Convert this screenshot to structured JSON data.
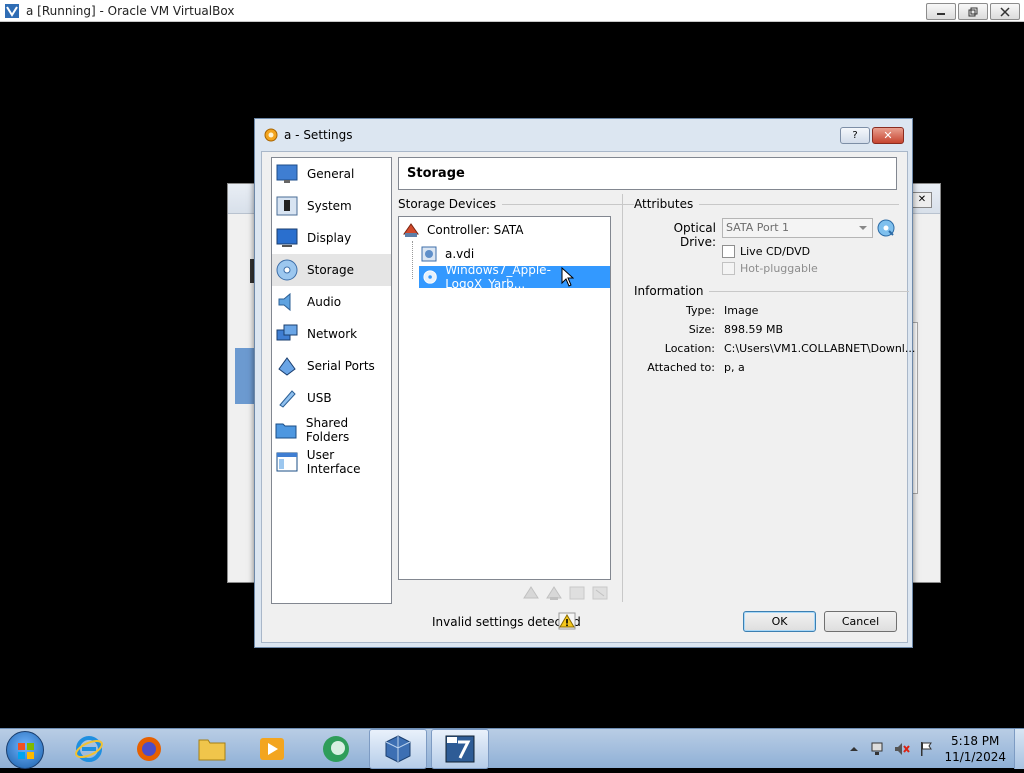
{
  "host": {
    "title": "a [Running] - Oracle VM VirtualBox"
  },
  "background_window": {
    "close_glyph": "✕"
  },
  "dialog": {
    "title": "a - Settings",
    "help_glyph": "?",
    "close_glyph": "✕",
    "page_title": "Storage",
    "categories": [
      {
        "label": "General",
        "icon": "general-icon"
      },
      {
        "label": "System",
        "icon": "system-icon"
      },
      {
        "label": "Display",
        "icon": "display-icon"
      },
      {
        "label": "Storage",
        "icon": "storage-icon",
        "selected": true
      },
      {
        "label": "Audio",
        "icon": "audio-icon"
      },
      {
        "label": "Network",
        "icon": "network-icon"
      },
      {
        "label": "Serial Ports",
        "icon": "serial-ports-icon"
      },
      {
        "label": "USB",
        "icon": "usb-icon"
      },
      {
        "label": "Shared Folders",
        "icon": "shared-folders-icon"
      },
      {
        "label": "User Interface",
        "icon": "user-interface-icon"
      }
    ],
    "storage_devices_header": "Storage Devices",
    "tree": {
      "controller": "Controller: SATA",
      "items": [
        {
          "label": "a.vdi",
          "icon": "hard-disk-icon"
        },
        {
          "label": "Windows7_Apple-LogoX_Yarb...",
          "icon": "optical-disc-icon",
          "selected": true
        }
      ]
    },
    "attributes": {
      "header": "Attributes",
      "optical_drive_label": "Optical Drive:",
      "optical_drive_value": "SATA Port 1",
      "live_cd_label": "Live CD/DVD",
      "hot_pluggable_label": "Hot-pluggable"
    },
    "information": {
      "header": "Information",
      "type_label": "Type:",
      "type_value": "Image",
      "size_label": "Size:",
      "size_value": "898.59 MB",
      "location_label": "Location:",
      "location_value": "C:\\Users\\VM1.COLLABNET\\Downl...",
      "attached_label": "Attached to:",
      "attached_value": "p, a"
    },
    "warning": "Invalid settings detected",
    "ok_label": "OK",
    "cancel_label": "Cancel"
  },
  "taskbar": {
    "time": "5:18 PM",
    "date": "11/1/2024"
  },
  "colors": {
    "selection": "#3399ff",
    "dialog_frame": "#dce6f1",
    "taskbar": "#a9c3e2"
  }
}
